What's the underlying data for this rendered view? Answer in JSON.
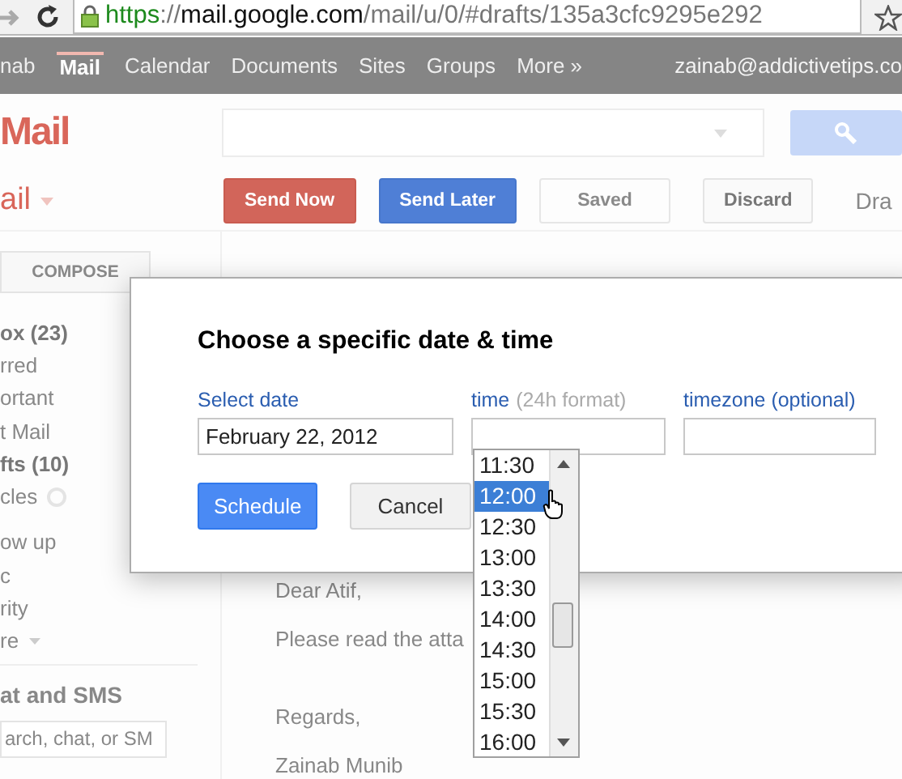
{
  "browser": {
    "url": [
      {
        "text": "https",
        "kind": "scheme"
      },
      {
        "text": "://",
        "kind": "path"
      },
      {
        "text": "mail.google.com",
        "kind": "host"
      },
      {
        "text": "/mail/u/0/#drafts/135a3cfc9295e292",
        "kind": "path"
      }
    ]
  },
  "google_bar": {
    "items": [
      {
        "label": "nab",
        "selected": false
      },
      {
        "label": "Mail",
        "selected": true
      },
      {
        "label": "Calendar",
        "selected": false
      },
      {
        "label": "Documents",
        "selected": false
      },
      {
        "label": "Sites",
        "selected": false
      },
      {
        "label": "Groups",
        "selected": false
      },
      {
        "label": "More »",
        "selected": false
      }
    ],
    "account": "zainab@addictivetips.co"
  },
  "header": {
    "logo": "Mail"
  },
  "toolbar": {
    "menu": "ail",
    "buttons": [
      {
        "label": "Send Now",
        "kind": "red"
      },
      {
        "label": "Send Later",
        "kind": "blue"
      },
      {
        "label": "Saved",
        "kind": "disabled"
      },
      {
        "label": "Discard",
        "kind": "plain"
      }
    ],
    "status": "Dra"
  },
  "sidebar": {
    "compose": "COMPOSE",
    "items": [
      {
        "label": "ox (23)",
        "unread": true
      },
      {
        "label": "rred",
        "unread": false
      },
      {
        "label": "ortant",
        "unread": false
      },
      {
        "label": "t Mail",
        "unread": false
      },
      {
        "label": "fts (10)",
        "unread": true
      },
      {
        "label": "cles",
        "unread": false
      },
      {
        "label": "ow up",
        "unread": false
      },
      {
        "label": "c",
        "unread": false
      },
      {
        "label": "rity",
        "unread": false
      },
      {
        "label": "re",
        "unread": false
      }
    ],
    "chat_title": "at and SMS",
    "chat_search": {
      "placeholder": "arch, chat, or SM"
    }
  },
  "message": {
    "lines": [
      "Dear Atif,",
      "Please read the atta",
      "Regards,",
      "Zainab Munib"
    ]
  },
  "dialog": {
    "title": "Choose a specific date & time",
    "date": {
      "label": "Select date",
      "value": "February 22, 2012"
    },
    "time": {
      "label": "time",
      "hint": "(24h format)"
    },
    "timezone": {
      "label": "timezone (optional)"
    },
    "buttons": [
      {
        "label": "Schedule",
        "kind": "primary"
      },
      {
        "label": "Cancel",
        "kind": "secondary"
      }
    ]
  },
  "time_dropdown": {
    "options": [
      {
        "label": "11:30",
        "selected": false
      },
      {
        "label": "12:00",
        "selected": true
      },
      {
        "label": "12:30",
        "selected": false
      },
      {
        "label": "13:00",
        "selected": false
      },
      {
        "label": "13:30",
        "selected": false
      },
      {
        "label": "14:00",
        "selected": false
      },
      {
        "label": "14:30",
        "selected": false
      },
      {
        "label": "15:00",
        "selected": false
      },
      {
        "label": "15:30",
        "selected": false
      },
      {
        "label": "16:00",
        "selected": false
      }
    ]
  }
}
